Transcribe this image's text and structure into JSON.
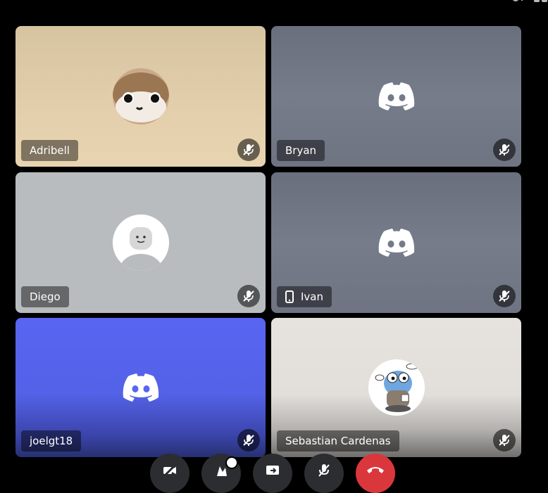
{
  "colors": {
    "background": "#000000",
    "tile_tan": "#e2cfac",
    "tile_gray": "#6f7584",
    "tile_lightgray": "#b9bcbf",
    "tile_blurple": "#5865f2",
    "tile_offwhite": "#e6e3df",
    "danger": "#da373c"
  },
  "participants": [
    {
      "name": "Adribell",
      "avatar": "plush-avatar",
      "muted": true
    },
    {
      "name": "Bryan",
      "avatar": "discord-logo-icon",
      "muted": true
    },
    {
      "name": "Diego",
      "avatar": "default-avatar",
      "muted": true
    },
    {
      "name": "Ivan",
      "avatar": "discord-logo-icon",
      "muted": true,
      "device_icon": "mobile-phone-icon"
    },
    {
      "name": "joelgt18",
      "avatar": "discord-logo-icon",
      "muted": true
    },
    {
      "name": "Sebastian Cardenas",
      "avatar": "gopher-avatar",
      "muted": true
    }
  ],
  "controls": [
    {
      "icon": "camera-off-icon"
    },
    {
      "icon": "activity-icon"
    },
    {
      "icon": "screen-share-icon"
    },
    {
      "icon": "mic-icon"
    },
    {
      "icon": "end-call-icon"
    }
  ]
}
